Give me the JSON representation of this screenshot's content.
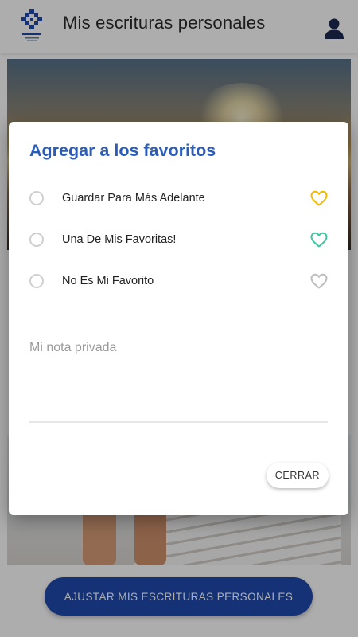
{
  "header": {
    "title": "Mis escrituras personales",
    "logo_icon": "la-victoria-logo-icon",
    "profile_icon": "user-profile-icon"
  },
  "background": {
    "adjust_button_label": "AJUSTAR MIS ESCRITURAS PERSONALES"
  },
  "dialog": {
    "title": "Agregar a los favoritos",
    "options": [
      {
        "label": "Guardar Para Más Adelante",
        "icon": "heart-outline-icon",
        "color": "#f5b800",
        "selected": false
      },
      {
        "label": "Una De Mis Favoritas!",
        "icon": "heart-outline-icon",
        "color": "#3cc7a0",
        "selected": false
      },
      {
        "label": "No Es Mi Favorito",
        "icon": "heart-outline-icon",
        "color": "#bdbdbd",
        "selected": false
      }
    ],
    "note_placeholder": "Mi nota privada",
    "note_value": "",
    "close_label": "CERRAR"
  },
  "colors": {
    "accent_title": "#2a5cb8",
    "primary_button": "#1f4bb0"
  }
}
